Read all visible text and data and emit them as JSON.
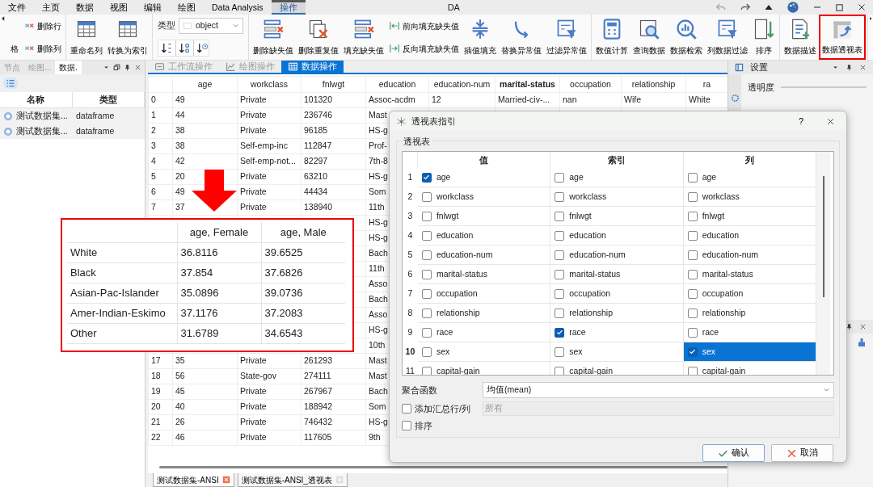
{
  "menu_tabs": [
    {
      "label": "文件",
      "selected": false
    },
    {
      "label": "主页",
      "selected": false
    },
    {
      "label": "数据",
      "selected": false
    },
    {
      "label": "视图",
      "selected": false
    },
    {
      "label": "编辑",
      "selected": false
    },
    {
      "label": "绘图",
      "selected": false
    },
    {
      "label": "Data Analysis",
      "selected": false
    },
    {
      "label": "操作",
      "selected": true
    }
  ],
  "window": {
    "title": "DA"
  },
  "ribbon": {
    "groups": [
      [
        {
          "kind": "cut",
          "label": "格"
        },
        {
          "kind": "stack",
          "buttons": [
            {
              "label": "删除行"
            },
            {
              "label": "删除列"
            }
          ]
        }
      ],
      [
        {
          "kind": "large",
          "label": "重命名列"
        },
        {
          "kind": "large",
          "label": "转换为索引"
        }
      ],
      [
        {
          "kind": "type",
          "label": "类型",
          "value": "object"
        }
      ],
      [
        {
          "kind": "large",
          "label": "删除缺失值"
        },
        {
          "kind": "large",
          "label": "删除重复值"
        },
        {
          "kind": "large",
          "label": "填充缺失值"
        },
        {
          "kind": "stack",
          "buttons": [
            {
              "label": "前向填充缺失值"
            },
            {
              "label": "反向填充缺失值"
            }
          ]
        },
        {
          "kind": "large",
          "label": "插值填充"
        },
        {
          "kind": "large",
          "label": "替换异常值"
        },
        {
          "kind": "large",
          "label": "过滤异常值"
        }
      ],
      [
        {
          "kind": "large",
          "label": "数值计算"
        },
        {
          "kind": "large",
          "label": "查询数据"
        },
        {
          "kind": "large",
          "label": "数据检索"
        },
        {
          "kind": "large",
          "label": "列数据过滤"
        },
        {
          "kind": "large",
          "label": "排序"
        }
      ],
      [
        {
          "kind": "large",
          "label": "数据描述"
        },
        {
          "kind": "large",
          "label": "数据透视表",
          "highlighted": true
        }
      ]
    ]
  },
  "left_panel": {
    "tabs": [
      {
        "label": "节点",
        "selected": false
      },
      {
        "label": "绘图...",
        "selected": false
      },
      {
        "label": "数据.",
        "selected": true
      }
    ],
    "columns": [
      "名称",
      "类型"
    ],
    "rows": [
      {
        "name": "测试数据集...",
        "type": "dataframe"
      },
      {
        "name": "测试数据集...",
        "type": "dataframe"
      }
    ]
  },
  "main_tabs": [
    {
      "label": "工作流操作",
      "selected": false
    },
    {
      "label": "绘图操作",
      "selected": false
    },
    {
      "label": "数据操作",
      "selected": true
    }
  ],
  "table": {
    "columns": [
      {
        "label": "age",
        "bold": false
      },
      {
        "label": "workclass",
        "bold": false
      },
      {
        "label": "fnlwgt",
        "bold": false
      },
      {
        "label": "education",
        "bold": false
      },
      {
        "label": "education-num",
        "bold": false
      },
      {
        "label": "marital-status",
        "bold": true
      },
      {
        "label": "occupation",
        "bold": false
      },
      {
        "label": "relationship",
        "bold": false
      },
      {
        "label": "ra",
        "bold": false
      }
    ],
    "rows": [
      {
        "index": "0",
        "cells": [
          "49",
          "Private",
          "101320",
          "Assoc-acdm",
          "12",
          "Married-civ-...",
          "nan",
          "Wife",
          "White"
        ]
      },
      {
        "index": "1",
        "cells": [
          "44",
          "Private",
          "236746",
          "Mast",
          null,
          null,
          null,
          null,
          null
        ]
      },
      {
        "index": "2",
        "cells": [
          "38",
          "Private",
          "96185",
          "HS-g",
          null,
          null,
          null,
          null,
          null
        ]
      },
      {
        "index": "3",
        "cells": [
          "38",
          "Self-emp-inc",
          "112847",
          "Prof-",
          null,
          null,
          null,
          null,
          null
        ]
      },
      {
        "index": "4",
        "cells": [
          "42",
          "Self-emp-not...",
          "82297",
          "7th-8",
          null,
          null,
          null,
          null,
          null
        ]
      },
      {
        "index": "5",
        "cells": [
          "20",
          "Private",
          "63210",
          "HS-g",
          null,
          null,
          null,
          null,
          null
        ]
      },
      {
        "index": "6",
        "cells": [
          "49",
          "Private",
          "44434",
          "Som",
          null,
          null,
          null,
          null,
          null
        ]
      },
      {
        "index": "7",
        "cells": [
          "37",
          "Private",
          "138940",
          "11th",
          null,
          null,
          null,
          null,
          null
        ]
      },
      {
        "index": null,
        "cells": [
          null,
          null,
          null,
          "HS-g",
          null,
          null,
          null,
          null,
          null
        ]
      },
      {
        "index": null,
        "cells": [
          null,
          null,
          null,
          "HS-g",
          null,
          null,
          null,
          null,
          null
        ]
      },
      {
        "index": null,
        "cells": [
          null,
          null,
          null,
          "Bach",
          null,
          null,
          null,
          null,
          null
        ]
      },
      {
        "index": null,
        "cells": [
          null,
          null,
          null,
          "11th",
          null,
          null,
          null,
          null,
          null
        ]
      },
      {
        "index": null,
        "cells": [
          null,
          null,
          null,
          "Asso",
          null,
          null,
          null,
          null,
          null
        ]
      },
      {
        "index": null,
        "cells": [
          null,
          null,
          null,
          "Bach",
          null,
          null,
          null,
          null,
          null
        ]
      },
      {
        "index": null,
        "cells": [
          null,
          null,
          null,
          "Asso",
          null,
          null,
          null,
          null,
          null
        ]
      },
      {
        "index": null,
        "cells": [
          null,
          null,
          null,
          "HS-g",
          null,
          null,
          null,
          null,
          null
        ]
      },
      {
        "index": null,
        "cells": [
          null,
          null,
          null,
          "10th",
          null,
          null,
          null,
          null,
          null
        ]
      },
      {
        "index": "17",
        "cells": [
          "35",
          "Private",
          "261293",
          "Mast",
          null,
          null,
          null,
          null,
          null
        ]
      },
      {
        "index": "18",
        "cells": [
          "56",
          "State-gov",
          "274111",
          "Mast",
          null,
          null,
          null,
          null,
          null
        ]
      },
      {
        "index": "19",
        "cells": [
          "45",
          "Private",
          "267967",
          "Bach",
          null,
          null,
          null,
          null,
          null
        ]
      },
      {
        "index": "20",
        "cells": [
          "40",
          "Private",
          "188942",
          "Som",
          null,
          null,
          null,
          null,
          null
        ]
      },
      {
        "index": "21",
        "cells": [
          "26",
          "Private",
          "746432",
          "HS-g",
          null,
          null,
          null,
          null,
          null
        ]
      },
      {
        "index": "22",
        "cells": [
          "46",
          "Private",
          "117605",
          "9th",
          null,
          null,
          null,
          null,
          null
        ]
      }
    ]
  },
  "bottom_tabs": [
    {
      "label": "测试数据集-ANSI",
      "selected": true
    },
    {
      "label": "测试数据集-ANSI_透视表",
      "selected": false
    }
  ],
  "right_panel": {
    "title": "设置",
    "opacity_label": "透明度"
  },
  "pivot_result": {
    "columns": [
      "age, Female",
      "age, Male"
    ],
    "rows": [
      {
        "label": "White",
        "values": [
          "36.8116",
          "39.6525"
        ]
      },
      {
        "label": "Black",
        "values": [
          "37.854",
          "37.6826"
        ]
      },
      {
        "label": "Asian-Pac-Islander",
        "values": [
          "35.0896",
          "39.0736"
        ]
      },
      {
        "label": "Amer-Indian-Eskimo",
        "values": [
          "37.1176",
          "37.2083"
        ]
      },
      {
        "label": "Other",
        "values": [
          "31.6789",
          "34.6543"
        ]
      }
    ]
  },
  "dialog": {
    "title": "透视表指引",
    "help": "?",
    "group_label": "透视表",
    "columns": [
      "值",
      "索引",
      "列"
    ],
    "rows": [
      {
        "number": "1",
        "cells": [
          {
            "label": "age",
            "checked": true,
            "selected": false
          },
          {
            "label": "age",
            "checked": false,
            "selected": false
          },
          {
            "label": "age",
            "checked": false,
            "selected": false
          }
        ]
      },
      {
        "number": "2",
        "cells": [
          {
            "label": "workclass",
            "checked": false,
            "selected": false
          },
          {
            "label": "workclass",
            "checked": false,
            "selected": false
          },
          {
            "label": "workclass",
            "checked": false,
            "selected": false
          }
        ]
      },
      {
        "number": "3",
        "cells": [
          {
            "label": "fnlwgt",
            "checked": false,
            "selected": false
          },
          {
            "label": "fnlwgt",
            "checked": false,
            "selected": false
          },
          {
            "label": "fnlwgt",
            "checked": false,
            "selected": false
          }
        ]
      },
      {
        "number": "4",
        "cells": [
          {
            "label": "education",
            "checked": false,
            "selected": false
          },
          {
            "label": "education",
            "checked": false,
            "selected": false
          },
          {
            "label": "education",
            "checked": false,
            "selected": false
          }
        ]
      },
      {
        "number": "5",
        "cells": [
          {
            "label": "education-num",
            "checked": false,
            "selected": false
          },
          {
            "label": "education-num",
            "checked": false,
            "selected": false
          },
          {
            "label": "education-num",
            "checked": false,
            "selected": false
          }
        ]
      },
      {
        "number": "6",
        "cells": [
          {
            "label": "marital-status",
            "checked": false,
            "selected": false
          },
          {
            "label": "marital-status",
            "checked": false,
            "selected": false
          },
          {
            "label": "marital-status",
            "checked": false,
            "selected": false
          }
        ]
      },
      {
        "number": "7",
        "cells": [
          {
            "label": "occupation",
            "checked": false,
            "selected": false
          },
          {
            "label": "occupation",
            "checked": false,
            "selected": false
          },
          {
            "label": "occupation",
            "checked": false,
            "selected": false
          }
        ]
      },
      {
        "number": "8",
        "cells": [
          {
            "label": "relationship",
            "checked": false,
            "selected": false
          },
          {
            "label": "relationship",
            "checked": false,
            "selected": false
          },
          {
            "label": "relationship",
            "checked": false,
            "selected": false
          }
        ]
      },
      {
        "number": "9",
        "cells": [
          {
            "label": "race",
            "checked": false,
            "selected": false
          },
          {
            "label": "race",
            "checked": true,
            "selected": false
          },
          {
            "label": "race",
            "checked": false,
            "selected": false
          }
        ]
      },
      {
        "number": "10",
        "cells": [
          {
            "label": "sex",
            "checked": false,
            "selected": false
          },
          {
            "label": "sex",
            "checked": false,
            "selected": false
          },
          {
            "label": "sex",
            "checked": true,
            "selected": true
          }
        ]
      },
      {
        "number": "11",
        "cells": [
          {
            "label": "capital-gain",
            "checked": false,
            "selected": false
          },
          {
            "label": "capital-gain",
            "checked": false,
            "selected": false
          },
          {
            "label": "capital-gain",
            "checked": false,
            "selected": false
          }
        ]
      }
    ],
    "aggregation": {
      "label": "聚合函数",
      "value": "均值(mean)"
    },
    "totals": {
      "label": "添加汇总行/列",
      "checked": false,
      "value": "所有",
      "disabled": true
    },
    "sort": {
      "label": "排序",
      "checked": false
    },
    "buttons": [
      {
        "label": "确认",
        "kind": "ok"
      },
      {
        "label": "取消",
        "kind": "cancel"
      }
    ]
  }
}
